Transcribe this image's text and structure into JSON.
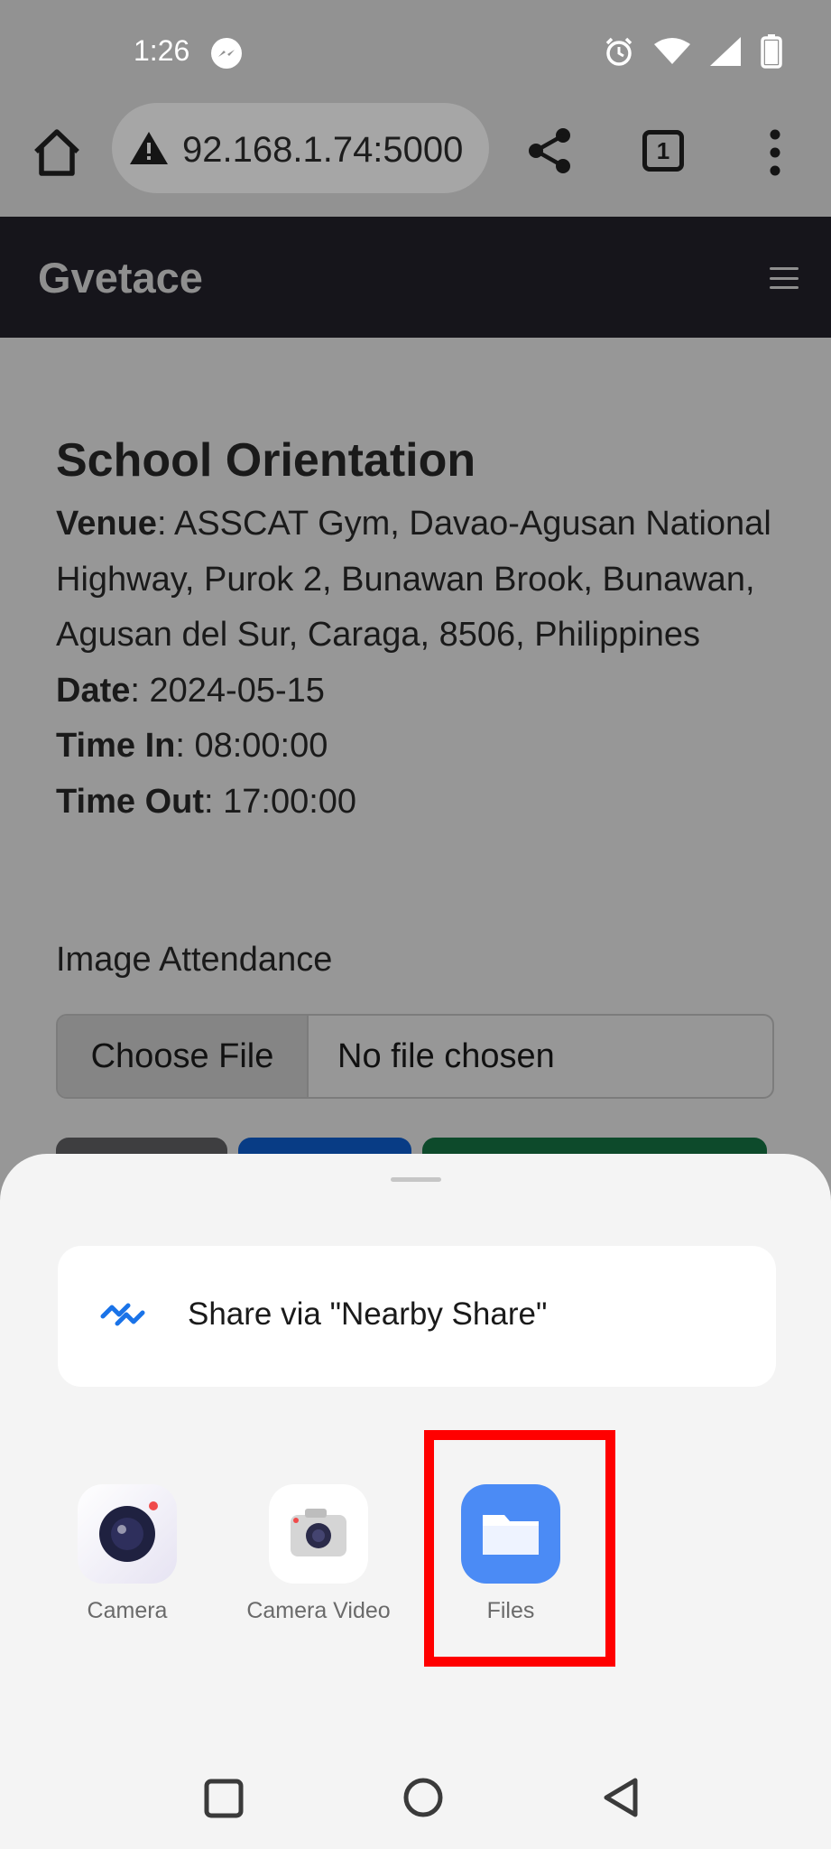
{
  "status_bar": {
    "time": "1:26"
  },
  "browser": {
    "url": "92.168.1.74:5000",
    "tab_count": "1"
  },
  "site": {
    "brand": "Gvetace"
  },
  "event": {
    "title": "School Orientation",
    "venue_label": "Venue",
    "venue": "ASSCAT Gym, Davao-Agusan National Highway, Purok 2, Bunawan Brook, Bunawan, Agusan del Sur, Caraga, 8506, Philippines",
    "date_label": "Date",
    "date": "2024-05-15",
    "time_in_label": "Time In",
    "time_in": "08:00:00",
    "time_out_label": "Time Out",
    "time_out": "17:00:00"
  },
  "form": {
    "image_label": "Image Attendance",
    "choose_file": "Choose File",
    "no_file": "No file chosen"
  },
  "share_sheet": {
    "nearby_share": "Share via \"Nearby Share\"",
    "apps": [
      {
        "label": "Camera",
        "icon": "camera-icon"
      },
      {
        "label": "Camera Video",
        "icon": "camera-video-icon"
      },
      {
        "label": "Files",
        "icon": "folder-icon"
      }
    ]
  },
  "colors": {
    "highlight": "#ff0000",
    "files_blue": "#4b8bf5",
    "nearby_blue": "#1a73e8"
  }
}
